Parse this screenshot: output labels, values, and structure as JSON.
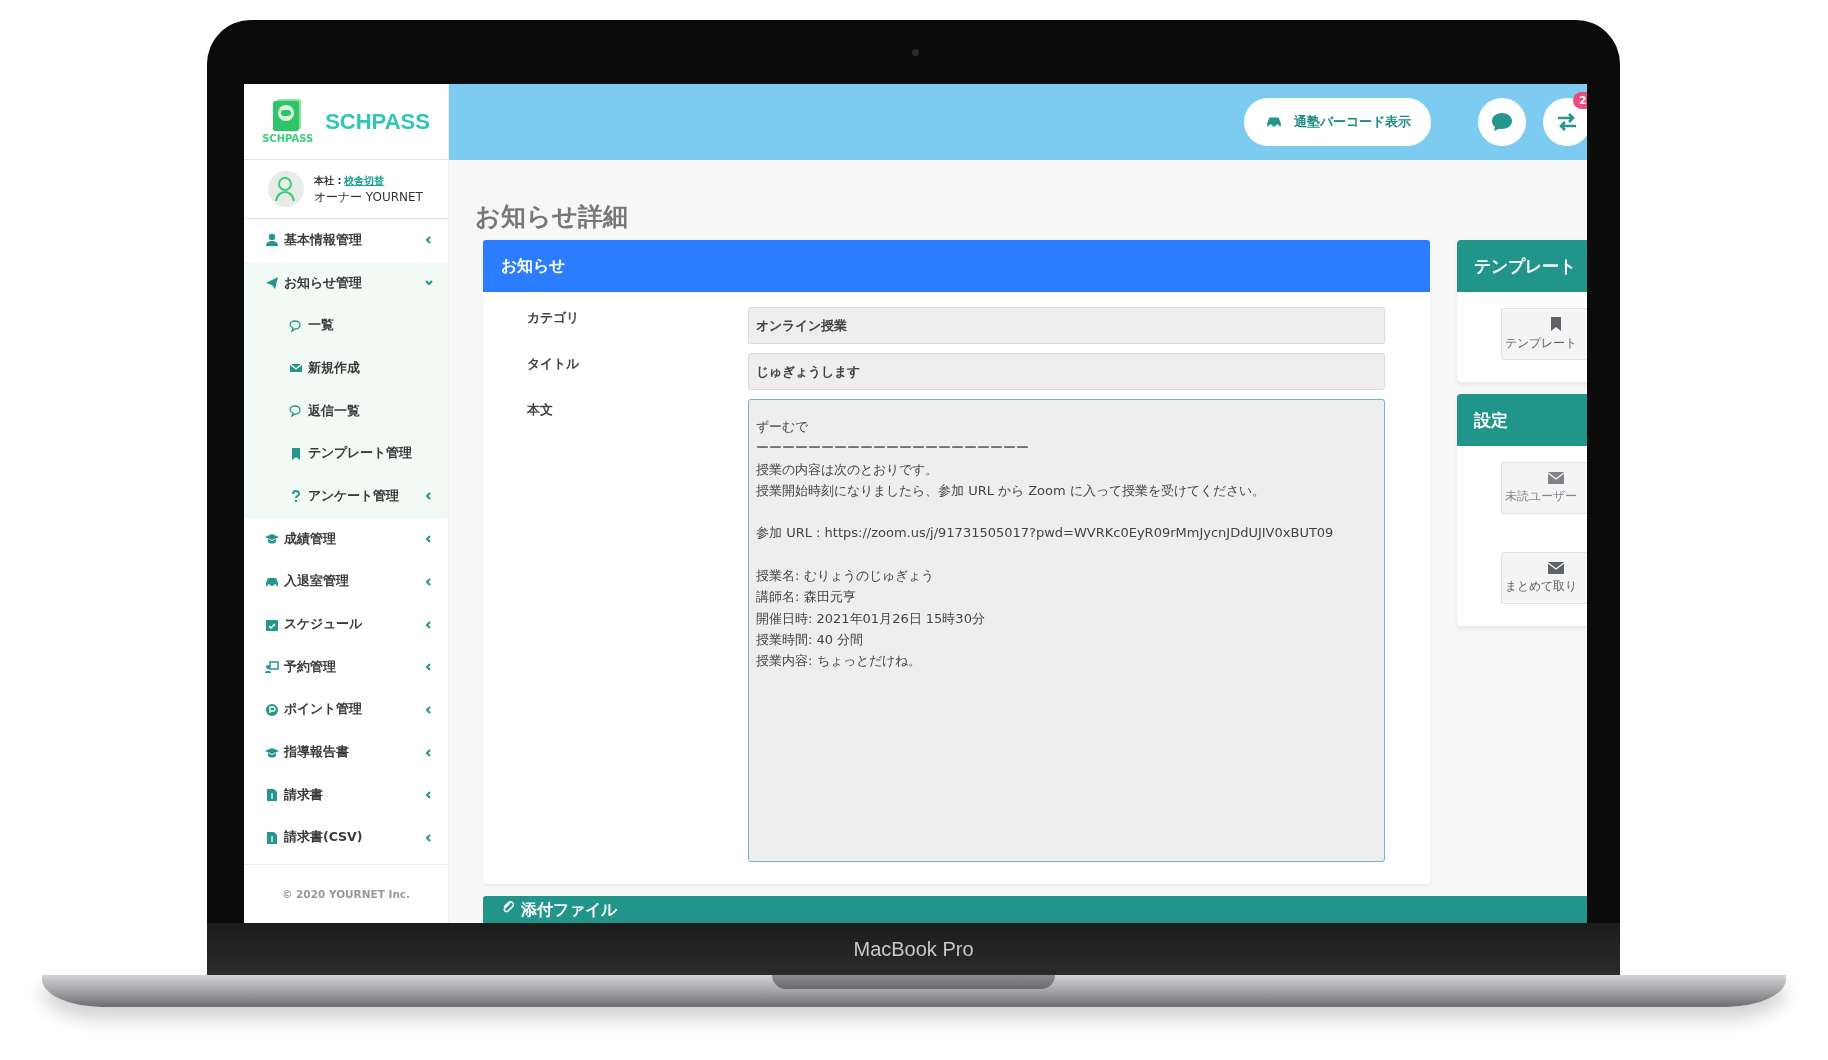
{
  "device": {
    "label": "MacBook Pro"
  },
  "sidebar": {
    "logo": {
      "name": "SCHPASS",
      "caption": "SCHPASS"
    },
    "profile": {
      "branch": "本社 :",
      "switch_link": "校舎切替",
      "user": "オーナー YOURNET"
    },
    "items": [
      {
        "label": "基本情報管理",
        "expanded": false
      },
      {
        "label": "お知らせ管理",
        "expanded": true,
        "children": [
          {
            "label": "一覧"
          },
          {
            "label": "新規作成"
          },
          {
            "label": "返信一覧"
          },
          {
            "label": "テンプレート管理"
          },
          {
            "label": "アンケート管理",
            "expanded": false
          }
        ]
      },
      {
        "label": "成績管理",
        "expanded": false
      },
      {
        "label": "入退室管理",
        "expanded": false
      },
      {
        "label": "スケジュール",
        "expanded": false
      },
      {
        "label": "予約管理",
        "expanded": false
      },
      {
        "label": "ポイント管理",
        "expanded": false
      },
      {
        "label": "指導報告書",
        "expanded": false
      },
      {
        "label": "請求書",
        "expanded": false
      },
      {
        "label": "請求書(CSV)",
        "expanded": false
      }
    ],
    "footer": "© 2020 YOURNET Inc."
  },
  "topbar": {
    "barcode_button": "通塾バーコード表示",
    "badge": "2"
  },
  "page_title": "お知らせ詳細",
  "notice_card": {
    "title": "お知らせ",
    "fields": [
      {
        "label": "カテゴリ",
        "kind": "input",
        "value": "オンライン授業"
      },
      {
        "label": "タイトル",
        "kind": "input",
        "value": "じゅぎょうします"
      },
      {
        "label": "本文",
        "kind": "textarea",
        "paragraphs": [
          [
            "ずーむで",
            "ーーーーーーーーーーーーーーーーーーーーー",
            "授業の内容は次のとおりです。",
            "授業開始時刻になりましたら、参加 URL から Zoom に入って授業を受けてください。"
          ],
          [
            "参加 URL : https://zoom.us/j/91731505017?pwd=WVRKc0EyR09rMmJycnJDdUJIV0xBUT09"
          ],
          [
            "授業名: むりょうのじゅぎょう",
            "講師名: 森田元亨",
            "開催日時: 2021年01月26日 15時30分",
            "授業時間: 40 分間",
            "授業内容: ちょっとだけね。"
          ]
        ]
      }
    ]
  },
  "attachment_card": {
    "title": "添付ファイル"
  },
  "side_panels": [
    {
      "title": "テンプレート",
      "buttons": [
        {
          "label": "テンプレート",
          "disabled": false
        }
      ]
    },
    {
      "title": "設定",
      "buttons": [
        {
          "label": "未読ユーザー",
          "disabled": true
        },
        {
          "label": "まとめて取り",
          "disabled": false
        }
      ]
    }
  ]
}
